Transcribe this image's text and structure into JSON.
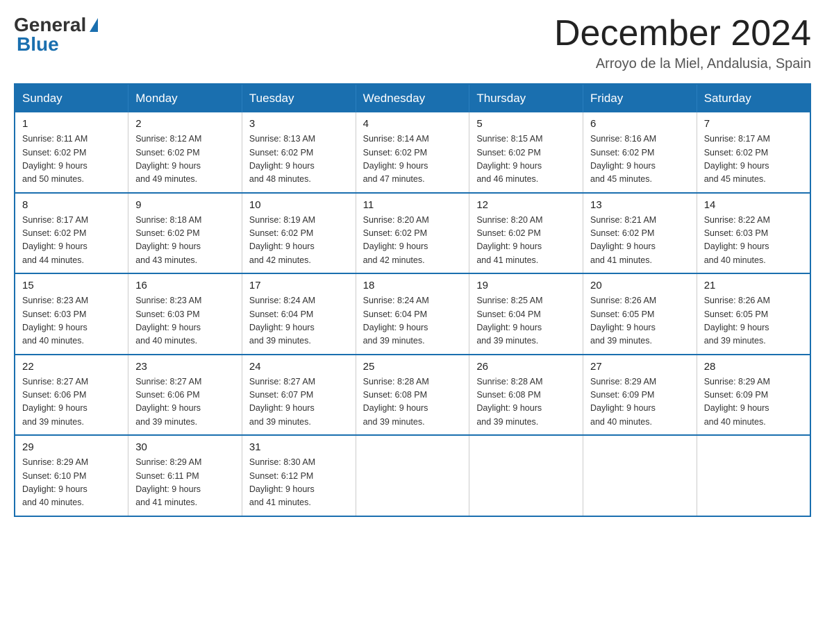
{
  "logo": {
    "general": "General",
    "blue": "Blue"
  },
  "title": {
    "month": "December 2024",
    "location": "Arroyo de la Miel, Andalusia, Spain"
  },
  "headers": [
    "Sunday",
    "Monday",
    "Tuesday",
    "Wednesday",
    "Thursday",
    "Friday",
    "Saturday"
  ],
  "weeks": [
    [
      {
        "day": "1",
        "info": "Sunrise: 8:11 AM\nSunset: 6:02 PM\nDaylight: 9 hours\nand 50 minutes."
      },
      {
        "day": "2",
        "info": "Sunrise: 8:12 AM\nSunset: 6:02 PM\nDaylight: 9 hours\nand 49 minutes."
      },
      {
        "day": "3",
        "info": "Sunrise: 8:13 AM\nSunset: 6:02 PM\nDaylight: 9 hours\nand 48 minutes."
      },
      {
        "day": "4",
        "info": "Sunrise: 8:14 AM\nSunset: 6:02 PM\nDaylight: 9 hours\nand 47 minutes."
      },
      {
        "day": "5",
        "info": "Sunrise: 8:15 AM\nSunset: 6:02 PM\nDaylight: 9 hours\nand 46 minutes."
      },
      {
        "day": "6",
        "info": "Sunrise: 8:16 AM\nSunset: 6:02 PM\nDaylight: 9 hours\nand 45 minutes."
      },
      {
        "day": "7",
        "info": "Sunrise: 8:17 AM\nSunset: 6:02 PM\nDaylight: 9 hours\nand 45 minutes."
      }
    ],
    [
      {
        "day": "8",
        "info": "Sunrise: 8:17 AM\nSunset: 6:02 PM\nDaylight: 9 hours\nand 44 minutes."
      },
      {
        "day": "9",
        "info": "Sunrise: 8:18 AM\nSunset: 6:02 PM\nDaylight: 9 hours\nand 43 minutes."
      },
      {
        "day": "10",
        "info": "Sunrise: 8:19 AM\nSunset: 6:02 PM\nDaylight: 9 hours\nand 42 minutes."
      },
      {
        "day": "11",
        "info": "Sunrise: 8:20 AM\nSunset: 6:02 PM\nDaylight: 9 hours\nand 42 minutes."
      },
      {
        "day": "12",
        "info": "Sunrise: 8:20 AM\nSunset: 6:02 PM\nDaylight: 9 hours\nand 41 minutes."
      },
      {
        "day": "13",
        "info": "Sunrise: 8:21 AM\nSunset: 6:02 PM\nDaylight: 9 hours\nand 41 minutes."
      },
      {
        "day": "14",
        "info": "Sunrise: 8:22 AM\nSunset: 6:03 PM\nDaylight: 9 hours\nand 40 minutes."
      }
    ],
    [
      {
        "day": "15",
        "info": "Sunrise: 8:23 AM\nSunset: 6:03 PM\nDaylight: 9 hours\nand 40 minutes."
      },
      {
        "day": "16",
        "info": "Sunrise: 8:23 AM\nSunset: 6:03 PM\nDaylight: 9 hours\nand 40 minutes."
      },
      {
        "day": "17",
        "info": "Sunrise: 8:24 AM\nSunset: 6:04 PM\nDaylight: 9 hours\nand 39 minutes."
      },
      {
        "day": "18",
        "info": "Sunrise: 8:24 AM\nSunset: 6:04 PM\nDaylight: 9 hours\nand 39 minutes."
      },
      {
        "day": "19",
        "info": "Sunrise: 8:25 AM\nSunset: 6:04 PM\nDaylight: 9 hours\nand 39 minutes."
      },
      {
        "day": "20",
        "info": "Sunrise: 8:26 AM\nSunset: 6:05 PM\nDaylight: 9 hours\nand 39 minutes."
      },
      {
        "day": "21",
        "info": "Sunrise: 8:26 AM\nSunset: 6:05 PM\nDaylight: 9 hours\nand 39 minutes."
      }
    ],
    [
      {
        "day": "22",
        "info": "Sunrise: 8:27 AM\nSunset: 6:06 PM\nDaylight: 9 hours\nand 39 minutes."
      },
      {
        "day": "23",
        "info": "Sunrise: 8:27 AM\nSunset: 6:06 PM\nDaylight: 9 hours\nand 39 minutes."
      },
      {
        "day": "24",
        "info": "Sunrise: 8:27 AM\nSunset: 6:07 PM\nDaylight: 9 hours\nand 39 minutes."
      },
      {
        "day": "25",
        "info": "Sunrise: 8:28 AM\nSunset: 6:08 PM\nDaylight: 9 hours\nand 39 minutes."
      },
      {
        "day": "26",
        "info": "Sunrise: 8:28 AM\nSunset: 6:08 PM\nDaylight: 9 hours\nand 39 minutes."
      },
      {
        "day": "27",
        "info": "Sunrise: 8:29 AM\nSunset: 6:09 PM\nDaylight: 9 hours\nand 40 minutes."
      },
      {
        "day": "28",
        "info": "Sunrise: 8:29 AM\nSunset: 6:09 PM\nDaylight: 9 hours\nand 40 minutes."
      }
    ],
    [
      {
        "day": "29",
        "info": "Sunrise: 8:29 AM\nSunset: 6:10 PM\nDaylight: 9 hours\nand 40 minutes."
      },
      {
        "day": "30",
        "info": "Sunrise: 8:29 AM\nSunset: 6:11 PM\nDaylight: 9 hours\nand 41 minutes."
      },
      {
        "day": "31",
        "info": "Sunrise: 8:30 AM\nSunset: 6:12 PM\nDaylight: 9 hours\nand 41 minutes."
      },
      null,
      null,
      null,
      null
    ]
  ]
}
